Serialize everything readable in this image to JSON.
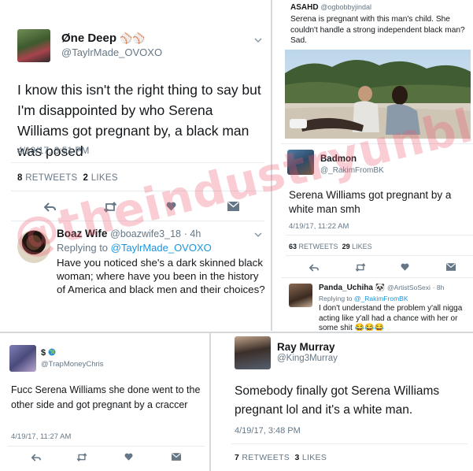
{
  "colors": {
    "accent": "#1b95e0",
    "text": "#14171a",
    "muted": "#657786",
    "watermark": "#ec5a6e"
  },
  "tweet1": {
    "name": "Øne Deep",
    "name_emoji": "⚾⚾",
    "handle": "@TaylrMade_OVOXO",
    "text": "I know this isn't the right thing to say but I'm disappointed by who Serena Williams got pregnant by, a black man was posed",
    "time": "4/19/17, 3:51 PM",
    "retweets_count": "8",
    "retweets_label": "RETWEETS",
    "likes_count": "2",
    "likes_label": "LIKES"
  },
  "reply1": {
    "name": "Boaz Wife",
    "handle": "@boazwife3_18",
    "age": "· 4h",
    "replying_prefix": "Replying to",
    "replying_to": "@TaylrMade_OVOXO",
    "text": "Have you noticed she's a dark skinned black woman; where have you been in the history of America and black men and their choices?"
  },
  "quote": {
    "name": "ASAHD",
    "handle": "@ogbobbyjindal",
    "text": "Serena is pregnant with this man's child. She couldn't handle a strong independent black man? Sad."
  },
  "tweet2": {
    "name": "Badmon",
    "handle": "@_RakimFromBK",
    "text": "Serena Williams got pregnant by a white man smh",
    "time": "4/19/17, 11:22 AM",
    "retweets_count": "63",
    "retweets_label": "RETWEETS",
    "likes_count": "29",
    "likes_label": "LIKES"
  },
  "reply2": {
    "name": "Panda_Uchiha",
    "name_emoji": "🐼",
    "handle": "@ArtistSoSexi",
    "age": "· 8h",
    "replying_prefix": "Replying to",
    "replying_to": "@_RakimFromBK",
    "text": "I don't understand the problem y'all nigga acting like y'all had a chance with her or some shit 😂😂😂"
  },
  "tweet3": {
    "name": "$",
    "handle": "@TrapMoneyChris",
    "text": "Fucc Serena Williams she done went to the other side and got pregnant by a craccer",
    "time": "4/19/17, 11:27 AM"
  },
  "tweet4": {
    "name": "Ray Murray",
    "handle": "@King3Murray",
    "text": "Somebody finally got Serena Williams pregnant lol and it's a white man.",
    "time": "4/19/17, 3:48 PM",
    "retweets_count": "7",
    "retweets_label": "RETWEETS",
    "likes_count": "3",
    "likes_label": "LIKES"
  },
  "watermark": "@theindustryunblast",
  "icons": [
    "reply-icon",
    "retweet-icon",
    "like-icon",
    "message-icon",
    "chevron-down-icon",
    "globe-icon"
  ]
}
